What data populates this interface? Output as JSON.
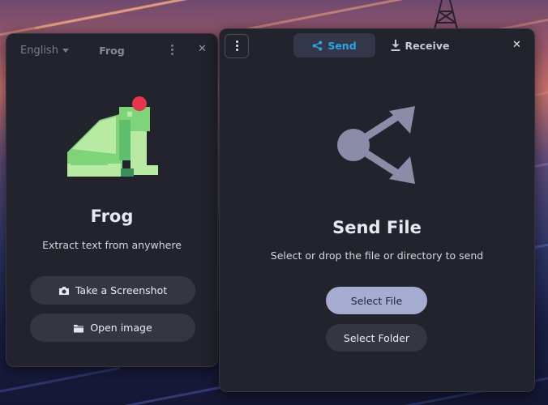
{
  "colors": {
    "window_bg": "#23232d",
    "button_bg": "#363643",
    "accent": "#2aa6e0",
    "primary_button": "#a6abd0",
    "frog_green_light": "#b8eaa4",
    "frog_green": "#7fd47a",
    "frog_dark": "#3b8f5b",
    "frog_red": "#e5364b",
    "share_icon": "#8a8ca8"
  },
  "frog_window": {
    "language": "English",
    "title": "Frog",
    "app_name": "Frog",
    "tagline": "Extract text from anywhere",
    "screenshot_button": "Take a Screenshot",
    "open_image_button": "Open image",
    "icons": [
      "caret-down-icon",
      "kebab-menu-icon",
      "close-icon",
      "camera-icon",
      "folder-icon"
    ]
  },
  "warp_window": {
    "tabs": [
      {
        "label": "Send",
        "icon": "share-icon",
        "active": true
      },
      {
        "label": "Receive",
        "icon": "download-icon",
        "active": false
      }
    ],
    "heading": "Send File",
    "description": "Select or drop the file or directory to send",
    "select_file_button": "Select File",
    "select_folder_button": "Select Folder",
    "icons": [
      "kebab-menu-icon",
      "close-icon",
      "share-large-icon"
    ]
  }
}
